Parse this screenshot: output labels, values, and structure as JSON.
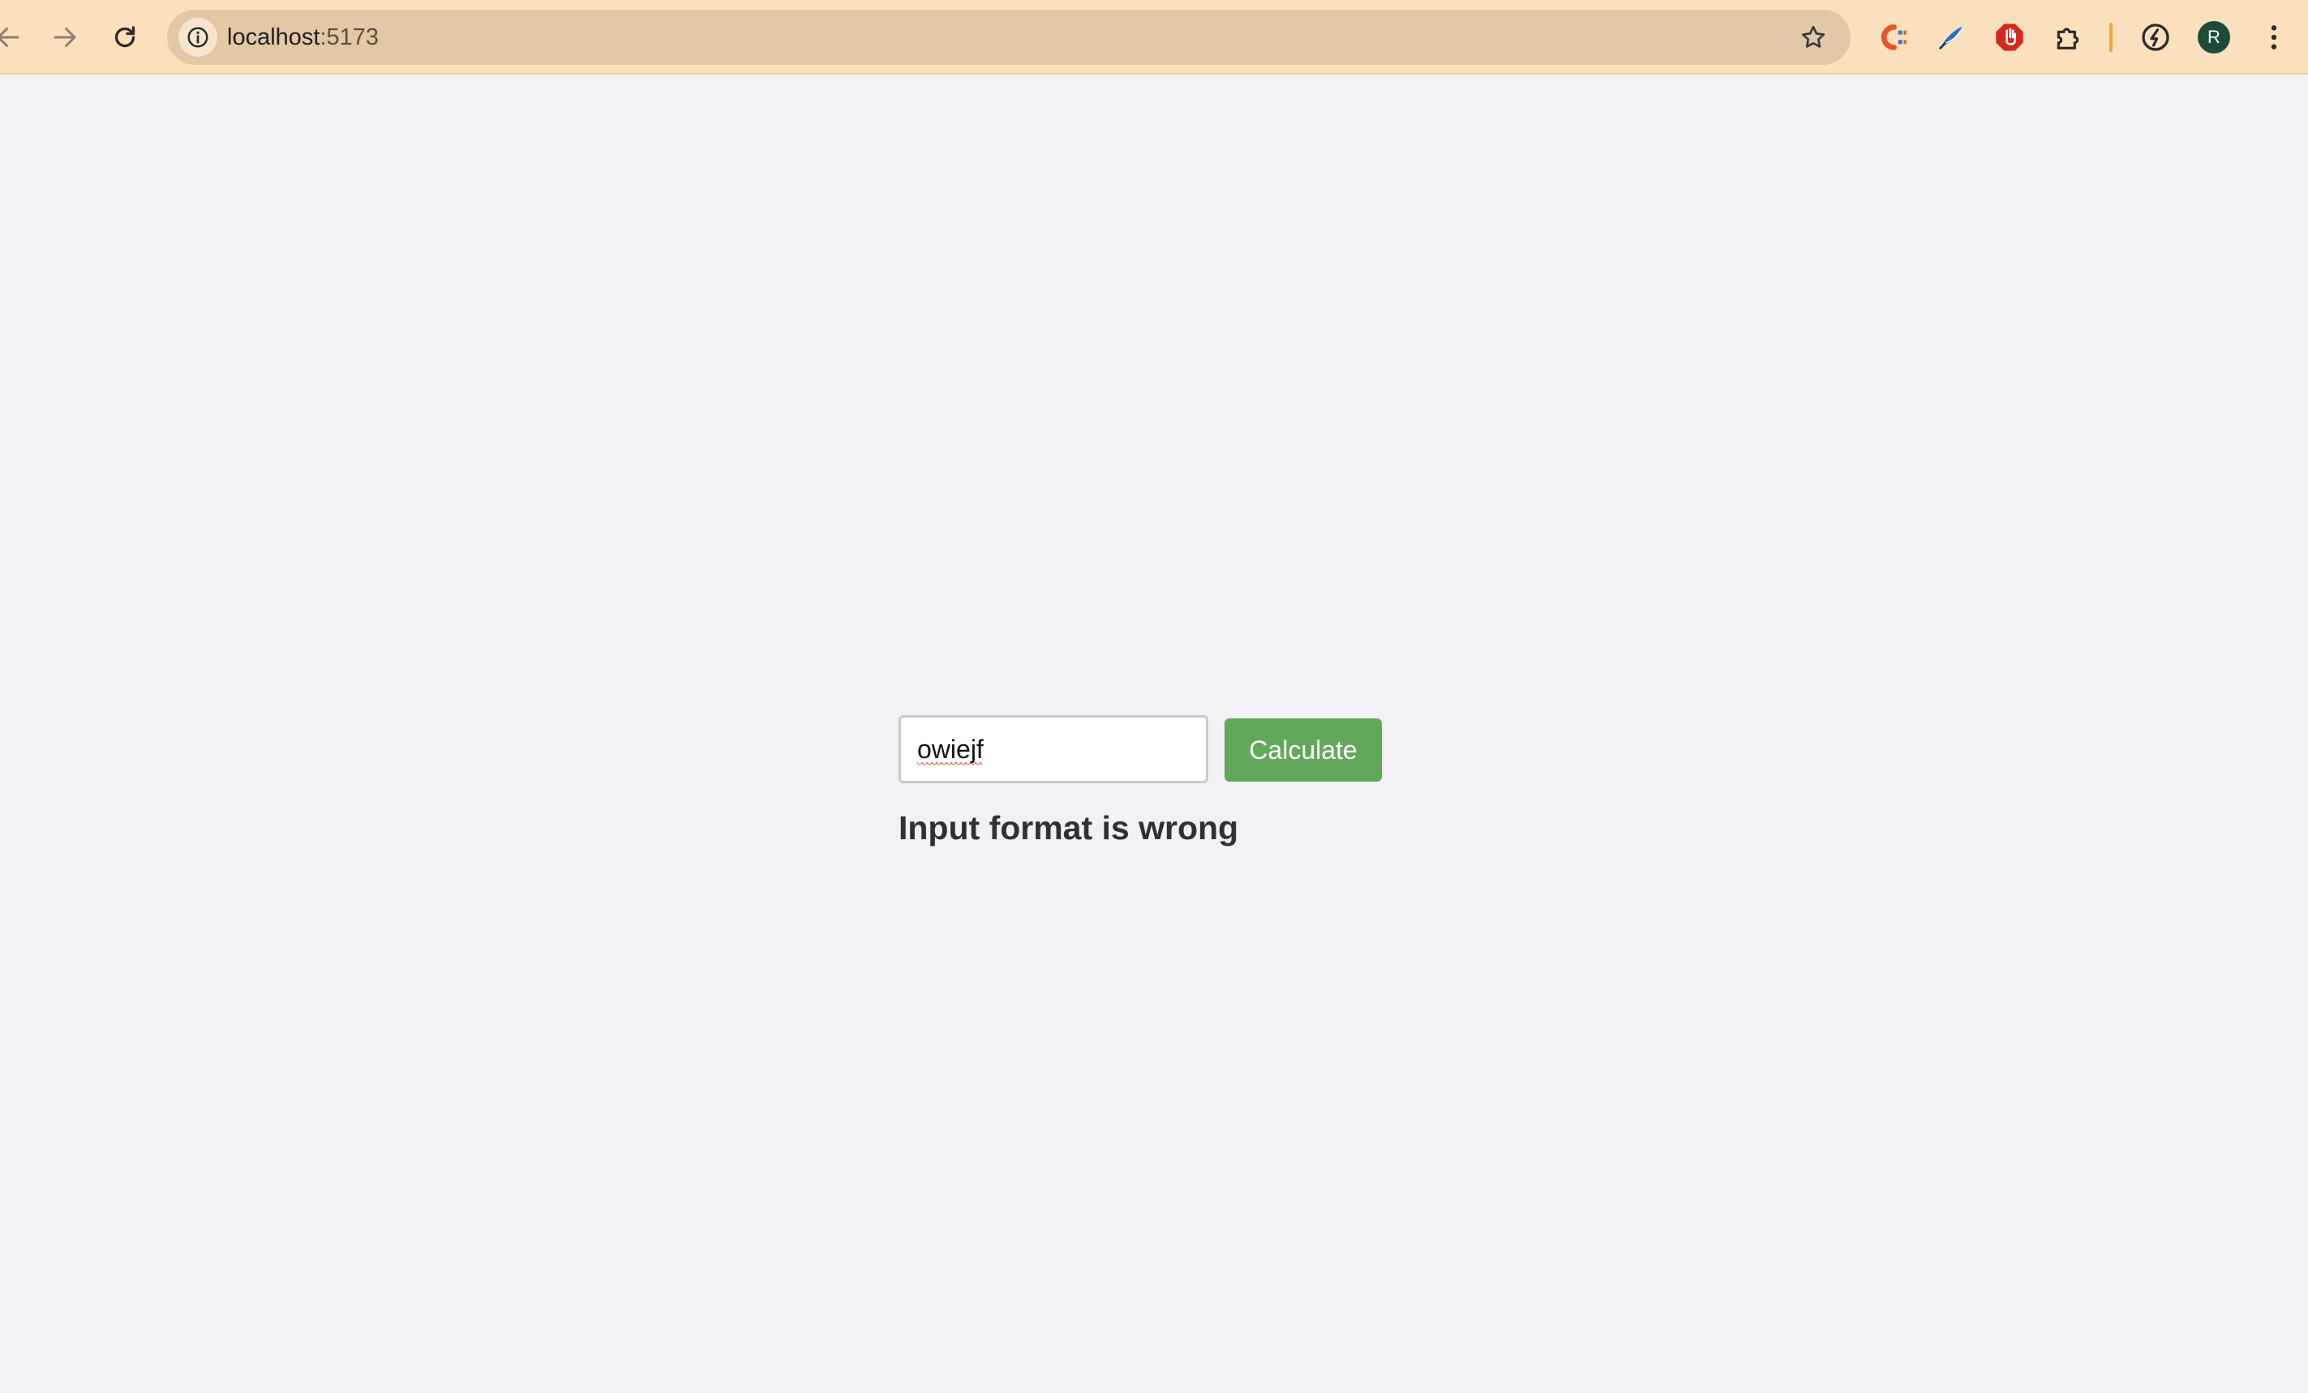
{
  "browser": {
    "url_host": "localhost",
    "url_port": ":5173",
    "profile_initial": "R",
    "theme_color": "#fbe0bd",
    "extensions": [
      "colorzilla-icon",
      "quill-pen-icon",
      "adblock-icon",
      "puzzle-extensions-icon",
      "speed-gauge-icon"
    ]
  },
  "calculator": {
    "input_value": "owiejf",
    "button_label": "Calculate",
    "button_color": "#61a85a"
  },
  "result": {
    "message": "Input format is wrong"
  }
}
